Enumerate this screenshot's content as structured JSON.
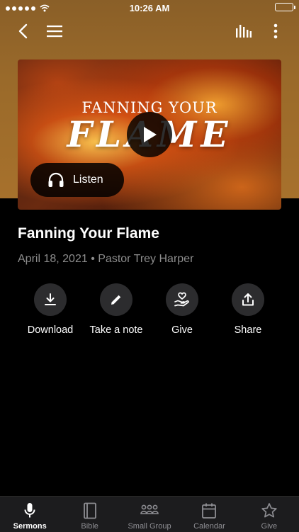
{
  "status_bar": {
    "time": "10:26 AM"
  },
  "artwork": {
    "subtitle_text": "FANNING YOUR",
    "title_text": "FLAME",
    "listen_label": "Listen"
  },
  "sermon": {
    "title": "Fanning Your Flame",
    "date": "April 18, 2021",
    "separator": "•",
    "speaker": "Pastor Trey Harper"
  },
  "actions": [
    {
      "label": "Download",
      "icon": "download-icon"
    },
    {
      "label": "Take a note",
      "icon": "pencil-icon"
    },
    {
      "label": "Give",
      "icon": "give-heart-icon"
    },
    {
      "label": "Share",
      "icon": "share-icon"
    }
  ],
  "tabs": [
    {
      "label": "Sermons",
      "icon": "microphone-icon",
      "active": true
    },
    {
      "label": "Bible",
      "icon": "book-icon",
      "active": false
    },
    {
      "label": "Small Group",
      "icon": "group-icon",
      "active": false
    },
    {
      "label": "Calendar",
      "icon": "calendar-icon",
      "active": false
    },
    {
      "label": "Give",
      "icon": "star-icon",
      "active": false
    }
  ],
  "colors": {
    "header_gradient": "#9a6a2a",
    "background": "#000000",
    "secondary_text": "#8d8d8d",
    "action_circle": "#2c2c2e",
    "tab_bar": "#1c1c1e"
  }
}
